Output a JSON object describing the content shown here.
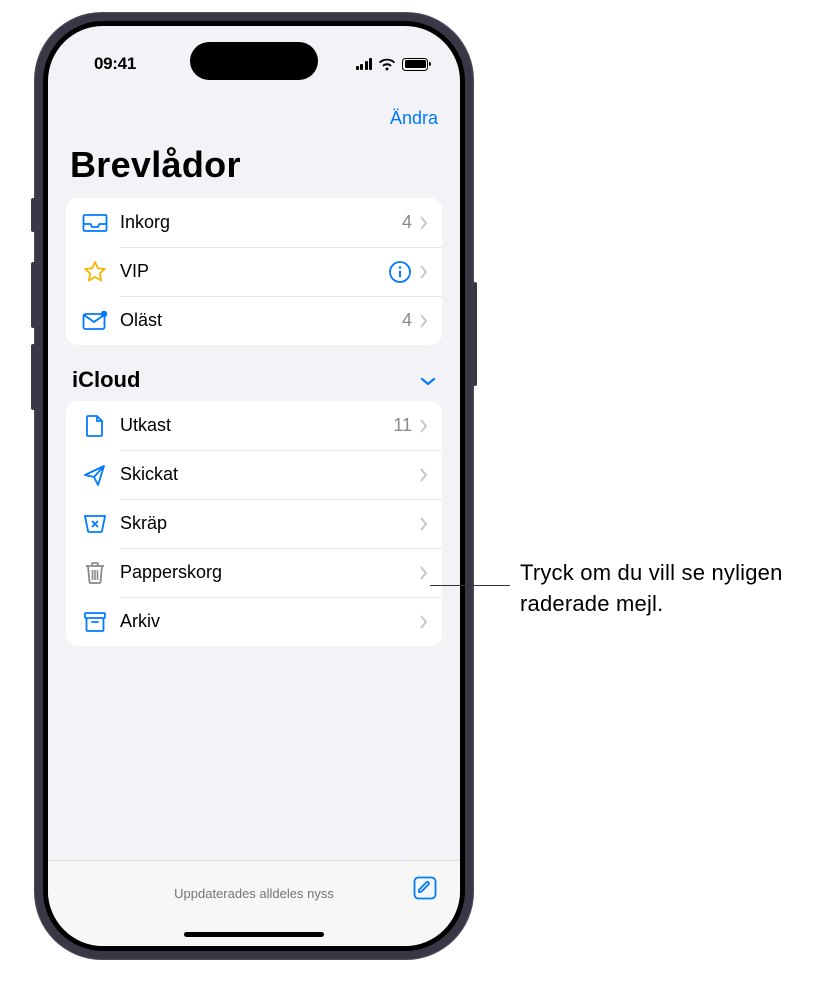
{
  "status": {
    "time": "09:41"
  },
  "nav": {
    "edit": "Ändra"
  },
  "title": "Brevlådor",
  "mailboxes": [
    {
      "icon": "inbox",
      "label": "Inkorg",
      "badge": "4"
    },
    {
      "icon": "star",
      "label": "VIP",
      "info": true
    },
    {
      "icon": "unread",
      "label": "Oläst",
      "badge": "4"
    }
  ],
  "account": {
    "name": "iCloud",
    "folders": [
      {
        "icon": "draft",
        "label": "Utkast",
        "badge": "11"
      },
      {
        "icon": "sent",
        "label": "Skickat"
      },
      {
        "icon": "junk",
        "label": "Skräp"
      },
      {
        "icon": "trash",
        "label": "Papperskorg"
      },
      {
        "icon": "archive",
        "label": "Arkiv"
      }
    ]
  },
  "toolbar": {
    "status": "Uppdaterades alldeles nyss"
  },
  "callout": "Tryck om du vill se nyligen raderade mejl."
}
